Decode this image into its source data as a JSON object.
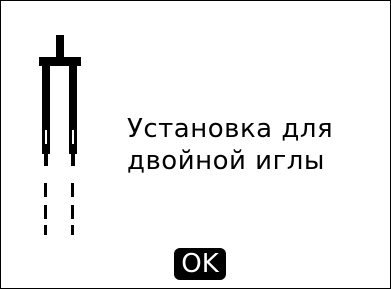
{
  "dialog": {
    "message_line1": "Установка для",
    "message_line2": "двойной иглы",
    "ok_label": "OK"
  },
  "icons": {
    "illustration": "twin-needle-icon"
  },
  "colors": {
    "foreground": "#000000",
    "background": "#ffffff"
  }
}
